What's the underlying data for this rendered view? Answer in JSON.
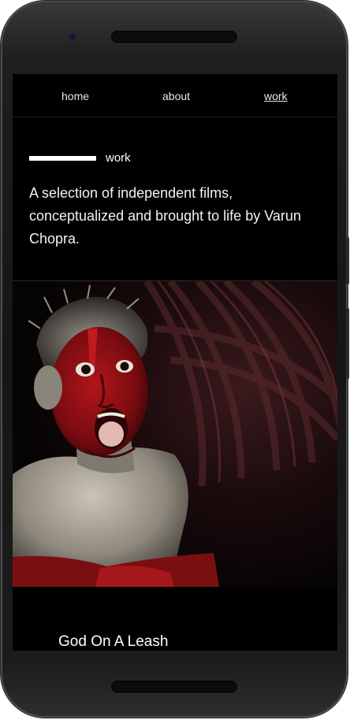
{
  "nav": {
    "items": [
      {
        "label": "home",
        "active": false
      },
      {
        "label": "about",
        "active": false
      },
      {
        "label": "work",
        "active": true
      }
    ]
  },
  "section": {
    "label": "work",
    "intro": "A selection of independent films, conceptualized and brought to life by Varun Chopra."
  },
  "film": {
    "title": "God On A Leash"
  },
  "colors": {
    "background": "#000000",
    "text": "#ffffff",
    "phone_frame": "#1c1c1c",
    "face_paint": "#8a0f12"
  }
}
